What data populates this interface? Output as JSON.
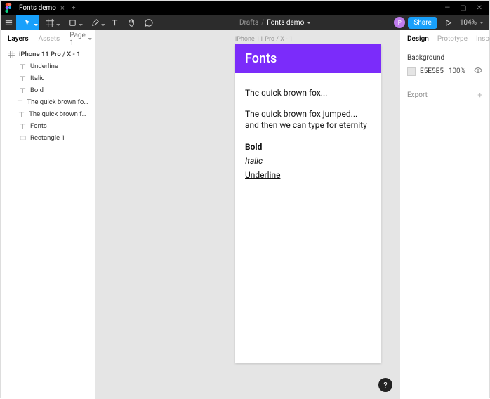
{
  "titlebar": {
    "tab_name": "Fonts demo"
  },
  "toolbar": {
    "breadcrumb_root": "Drafts",
    "breadcrumb_file": "Fonts demo",
    "avatar_initial": "P",
    "share_label": "Share",
    "zoom": "104%"
  },
  "left_panel": {
    "tab_layers": "Layers",
    "tab_assets": "Assets",
    "page_label": "Page 1",
    "frame_name": "iPhone 11 Pro / X - 1",
    "layers": [
      "Underline",
      "Italic",
      "Bold",
      "The quick brown fox jumped......",
      "The quick brown fox...",
      "Fonts",
      "Rectangle 1"
    ]
  },
  "canvas": {
    "frame_label": "iPhone 11 Pro / X - 1",
    "artboard": {
      "header": "Fonts",
      "sample1": "The quick brown fox...",
      "sample2": "The quick brown fox jumped... and then we can type for eternity",
      "bold": "Bold",
      "italic": "Italic",
      "underline": "Underline"
    }
  },
  "right_panel": {
    "tab_design": "Design",
    "tab_prototype": "Prototype",
    "tab_inspect": "Inspect",
    "bg_section": "Background",
    "bg_hex": "E5E5E5",
    "bg_opacity": "100%",
    "export_label": "Export"
  },
  "help": "?"
}
